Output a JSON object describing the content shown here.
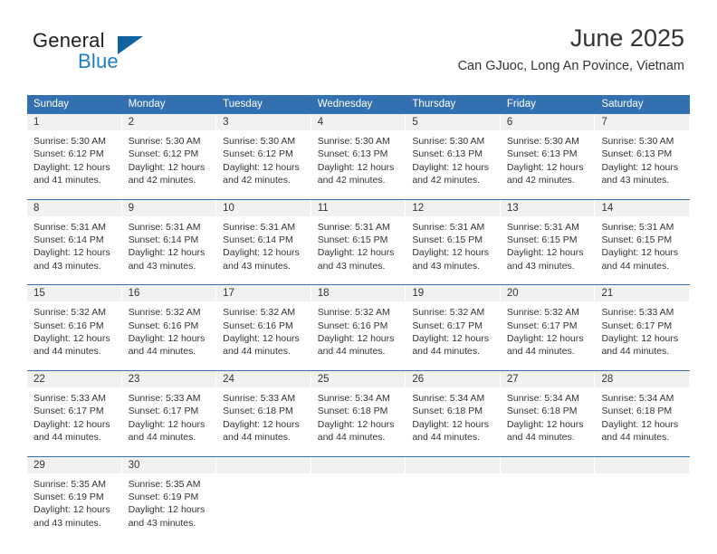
{
  "brand": {
    "name_top": "General",
    "name_bottom": "Blue",
    "triangle_color": "#11639f",
    "blue_color": "#1d7cc4"
  },
  "header": {
    "title": "June 2025",
    "subtitle": "Can GJuoc, Long An Povince, Vietnam"
  },
  "theme": {
    "header_blue": "#346FAF",
    "day_band_gray": "#f1f1f1",
    "text_color": "#333333"
  },
  "weekdays": [
    "Sunday",
    "Monday",
    "Tuesday",
    "Wednesday",
    "Thursday",
    "Friday",
    "Saturday"
  ],
  "weeks": [
    [
      {
        "day": "1",
        "lines": [
          "Sunrise: 5:30 AM",
          "Sunset: 6:12 PM",
          "Daylight: 12 hours",
          "and 41 minutes."
        ]
      },
      {
        "day": "2",
        "lines": [
          "Sunrise: 5:30 AM",
          "Sunset: 6:12 PM",
          "Daylight: 12 hours",
          "and 42 minutes."
        ]
      },
      {
        "day": "3",
        "lines": [
          "Sunrise: 5:30 AM",
          "Sunset: 6:12 PM",
          "Daylight: 12 hours",
          "and 42 minutes."
        ]
      },
      {
        "day": "4",
        "lines": [
          "Sunrise: 5:30 AM",
          "Sunset: 6:13 PM",
          "Daylight: 12 hours",
          "and 42 minutes."
        ]
      },
      {
        "day": "5",
        "lines": [
          "Sunrise: 5:30 AM",
          "Sunset: 6:13 PM",
          "Daylight: 12 hours",
          "and 42 minutes."
        ]
      },
      {
        "day": "6",
        "lines": [
          "Sunrise: 5:30 AM",
          "Sunset: 6:13 PM",
          "Daylight: 12 hours",
          "and 42 minutes."
        ]
      },
      {
        "day": "7",
        "lines": [
          "Sunrise: 5:30 AM",
          "Sunset: 6:13 PM",
          "Daylight: 12 hours",
          "and 43 minutes."
        ]
      }
    ],
    [
      {
        "day": "8",
        "lines": [
          "Sunrise: 5:31 AM",
          "Sunset: 6:14 PM",
          "Daylight: 12 hours",
          "and 43 minutes."
        ]
      },
      {
        "day": "9",
        "lines": [
          "Sunrise: 5:31 AM",
          "Sunset: 6:14 PM",
          "Daylight: 12 hours",
          "and 43 minutes."
        ]
      },
      {
        "day": "10",
        "lines": [
          "Sunrise: 5:31 AM",
          "Sunset: 6:14 PM",
          "Daylight: 12 hours",
          "and 43 minutes."
        ]
      },
      {
        "day": "11",
        "lines": [
          "Sunrise: 5:31 AM",
          "Sunset: 6:15 PM",
          "Daylight: 12 hours",
          "and 43 minutes."
        ]
      },
      {
        "day": "12",
        "lines": [
          "Sunrise: 5:31 AM",
          "Sunset: 6:15 PM",
          "Daylight: 12 hours",
          "and 43 minutes."
        ]
      },
      {
        "day": "13",
        "lines": [
          "Sunrise: 5:31 AM",
          "Sunset: 6:15 PM",
          "Daylight: 12 hours",
          "and 43 minutes."
        ]
      },
      {
        "day": "14",
        "lines": [
          "Sunrise: 5:31 AM",
          "Sunset: 6:15 PM",
          "Daylight: 12 hours",
          "and 44 minutes."
        ]
      }
    ],
    [
      {
        "day": "15",
        "lines": [
          "Sunrise: 5:32 AM",
          "Sunset: 6:16 PM",
          "Daylight: 12 hours",
          "and 44 minutes."
        ]
      },
      {
        "day": "16",
        "lines": [
          "Sunrise: 5:32 AM",
          "Sunset: 6:16 PM",
          "Daylight: 12 hours",
          "and 44 minutes."
        ]
      },
      {
        "day": "17",
        "lines": [
          "Sunrise: 5:32 AM",
          "Sunset: 6:16 PM",
          "Daylight: 12 hours",
          "and 44 minutes."
        ]
      },
      {
        "day": "18",
        "lines": [
          "Sunrise: 5:32 AM",
          "Sunset: 6:16 PM",
          "Daylight: 12 hours",
          "and 44 minutes."
        ]
      },
      {
        "day": "19",
        "lines": [
          "Sunrise: 5:32 AM",
          "Sunset: 6:17 PM",
          "Daylight: 12 hours",
          "and 44 minutes."
        ]
      },
      {
        "day": "20",
        "lines": [
          "Sunrise: 5:32 AM",
          "Sunset: 6:17 PM",
          "Daylight: 12 hours",
          "and 44 minutes."
        ]
      },
      {
        "day": "21",
        "lines": [
          "Sunrise: 5:33 AM",
          "Sunset: 6:17 PM",
          "Daylight: 12 hours",
          "and 44 minutes."
        ]
      }
    ],
    [
      {
        "day": "22",
        "lines": [
          "Sunrise: 5:33 AM",
          "Sunset: 6:17 PM",
          "Daylight: 12 hours",
          "and 44 minutes."
        ]
      },
      {
        "day": "23",
        "lines": [
          "Sunrise: 5:33 AM",
          "Sunset: 6:17 PM",
          "Daylight: 12 hours",
          "and 44 minutes."
        ]
      },
      {
        "day": "24",
        "lines": [
          "Sunrise: 5:33 AM",
          "Sunset: 6:18 PM",
          "Daylight: 12 hours",
          "and 44 minutes."
        ]
      },
      {
        "day": "25",
        "lines": [
          "Sunrise: 5:34 AM",
          "Sunset: 6:18 PM",
          "Daylight: 12 hours",
          "and 44 minutes."
        ]
      },
      {
        "day": "26",
        "lines": [
          "Sunrise: 5:34 AM",
          "Sunset: 6:18 PM",
          "Daylight: 12 hours",
          "and 44 minutes."
        ]
      },
      {
        "day": "27",
        "lines": [
          "Sunrise: 5:34 AM",
          "Sunset: 6:18 PM",
          "Daylight: 12 hours",
          "and 44 minutes."
        ]
      },
      {
        "day": "28",
        "lines": [
          "Sunrise: 5:34 AM",
          "Sunset: 6:18 PM",
          "Daylight: 12 hours",
          "and 44 minutes."
        ]
      }
    ],
    [
      {
        "day": "29",
        "lines": [
          "Sunrise: 5:35 AM",
          "Sunset: 6:19 PM",
          "Daylight: 12 hours",
          "and 43 minutes."
        ]
      },
      {
        "day": "30",
        "lines": [
          "Sunrise: 5:35 AM",
          "Sunset: 6:19 PM",
          "Daylight: 12 hours",
          "and 43 minutes."
        ]
      },
      {
        "day": "",
        "lines": []
      },
      {
        "day": "",
        "lines": []
      },
      {
        "day": "",
        "lines": []
      },
      {
        "day": "",
        "lines": []
      },
      {
        "day": "",
        "lines": []
      }
    ]
  ]
}
